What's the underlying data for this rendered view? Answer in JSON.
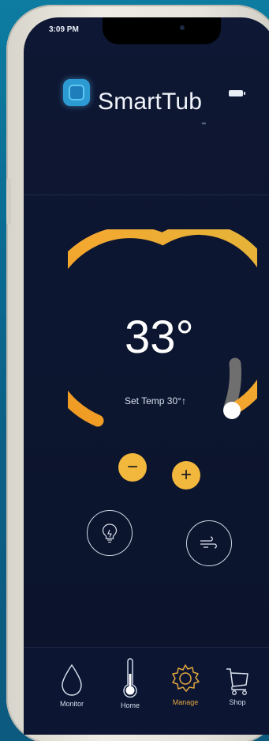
{
  "status": {
    "time": "3:09 PM"
  },
  "brand": {
    "name": "SmartTub",
    "trademark": "™"
  },
  "thermostat": {
    "current_temp": "33°",
    "set_temp_label": "Set Temp 30°↑",
    "dial_level": 0.82
  },
  "controls": {
    "decrease_symbol": "−",
    "increase_symbol": "+",
    "light_icon": "lightbulb-icon",
    "jets_icon": "air-flow-icon"
  },
  "tabs": [
    {
      "label": "Monitor",
      "icon": "water-drop-icon",
      "active": false
    },
    {
      "label": "Home",
      "icon": "thermometer-icon",
      "active": false
    },
    {
      "label": "Manage",
      "icon": "gear-icon",
      "active": true
    },
    {
      "label": "Shop",
      "icon": "cart-icon",
      "active": false
    }
  ],
  "colors": {
    "accent": "#f2b73d",
    "arc_start": "#f0a42a",
    "arc_end": "#e2b53a",
    "screen_bg": "#0d1630",
    "active_tab": "#e3a63d"
  }
}
